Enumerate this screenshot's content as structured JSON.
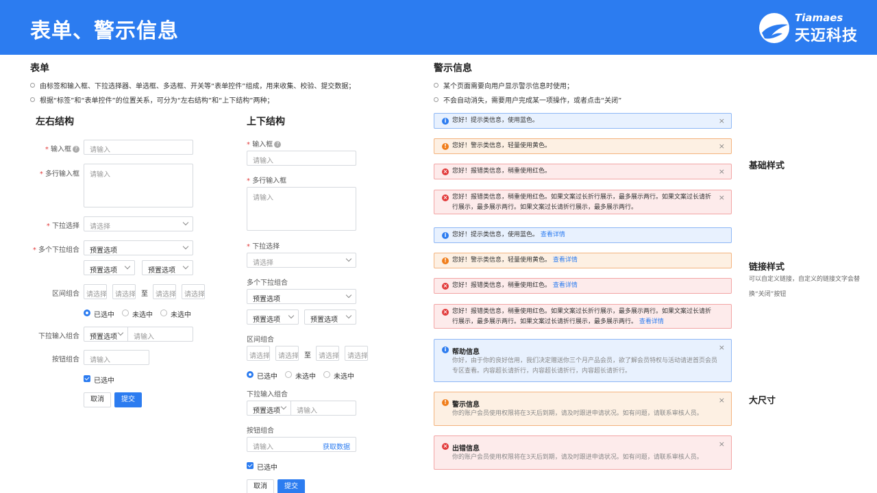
{
  "header": {
    "title": "表单、警示信息",
    "logo_en": "Tiamaes",
    "logo_cn": "天迈科技"
  },
  "form_section": {
    "title": "表单",
    "bullets": [
      "由标签和输入框、下拉选择器、单选框、多选框、开关等“表单控件”组成，用来收集、校验、提交数据；",
      "根据“标签”和“表单控件”的位置关系，可分为“左右结构”和“上下结构”两种；"
    ]
  },
  "lr": {
    "title": "左右结构",
    "input_label": "输入框",
    "input_placeholder": "请输入",
    "textarea_label": "多行输入框",
    "textarea_placeholder": "请输入",
    "select_label": "下拉选择",
    "select_placeholder": "请选择",
    "multi_label": "多个下拉组合",
    "multi_value": "预置选项",
    "multi_value2": "预置选项",
    "multi_value3": "预置选项",
    "range_label": "区间组合",
    "range_ph": "请选择",
    "range_sep": "至",
    "radio_on": "已选中",
    "radio_off1": "未选中",
    "radio_off2": "未选中",
    "dropin_label": "下拉输入组合",
    "dropin_value": "预置选项",
    "dropin_ph": "请输入",
    "btngrp_label": "按钮组合",
    "btngrp_ph": "请输入",
    "check_label": "已选中",
    "cancel": "取消",
    "submit": "提交"
  },
  "tb": {
    "title": "上下结构",
    "input_label": "输入框",
    "input_placeholder": "请输入",
    "textarea_label": "多行输入框",
    "textarea_placeholder": "请输入",
    "select_label": "下拉选择",
    "select_placeholder": "请选择",
    "multi_label": "多个下拉组合",
    "multi_value": "预置选项",
    "multi_value2": "预置选项",
    "multi_value3": "预置选项",
    "range_label": "区间组合",
    "range_ph": "请选择",
    "range_sep": "至",
    "radio_on": "已选中",
    "radio_off1": "未选中",
    "radio_off2": "未选中",
    "dropin_label": "下拉输入组合",
    "dropin_value": "预置选项",
    "dropin_ph": "请输入",
    "btngrp_label": "按钮组合",
    "btngrp_ph": "请输入",
    "btngrp_link": "获取数据",
    "check_label": "已选中",
    "cancel": "取消",
    "submit": "提交"
  },
  "alert_section": {
    "title": "警示信息",
    "bullets": [
      "某个页面需要向用户显示警示信息时使用；",
      "不会自动消失，需要用户完成某一项操作，或者点击“关闭”"
    ]
  },
  "alerts_basic": [
    {
      "msg": "您好！提示类信息，使用蓝色。"
    },
    {
      "msg": "您好！警示类信息，轻量使用黄色。"
    },
    {
      "msg": "您好！报错类信息，稍重使用红色。"
    },
    {
      "msg": "您好！报错类信息，稍重使用红色。如果文案过长折行展示，最多展示两行。如果文案过长请折行展示，最多展示两行。如果文案过长请折行展示，最多展示两行。"
    }
  ],
  "alerts_link": [
    {
      "msg": "您好！提示类信息，使用蓝色。",
      "link": "查看详情"
    },
    {
      "msg": "您好！警示类信息，轻量使用黄色。",
      "link": "查看详情"
    },
    {
      "msg": "您好！报错类信息，稍重使用红色。",
      "link": "查看详情"
    },
    {
      "msg": "您好！报错类信息，稍重使用红色。如果文案过长折行展示，最多展示两行。如果文案过长请折行展示，最多展示两行。如果文案过长请折行展示，最多展示两行。",
      "link": "查看详情"
    }
  ],
  "alerts_big": [
    {
      "title": "帮助信息",
      "desc": "你好，由于你的良好信用，我们决定赠送你三个月产品会员，欲了解会员特权与活动请进首页会员专区查看。内容超长请折行，内容超长请折行，内容超长请折行。"
    },
    {
      "title": "警示信息",
      "desc": "你的账户会员使用权限将在3天后到期，请及时跟进申请状况。如有问题，请联系审核人员。"
    },
    {
      "title": "出错信息",
      "desc": "你的账户会员使用权限将在3天后到期，请及时跟进申请状况。如有问题，请联系审核人员。"
    }
  ],
  "side": {
    "basic": "基础样式",
    "link": "链接样式",
    "link_desc": "可以自定义链接，自定义的链接文字会替换“关闭”按钮",
    "big": "大尺寸"
  },
  "icons": {
    "close": "×",
    "info": "i",
    "warn": "!",
    "err": "×"
  },
  "colors": {
    "primary": "#2c7cf0",
    "info_bg": "#e8f1fe",
    "warn_bg": "#fdf0e3",
    "err_bg": "#fdebeb"
  }
}
